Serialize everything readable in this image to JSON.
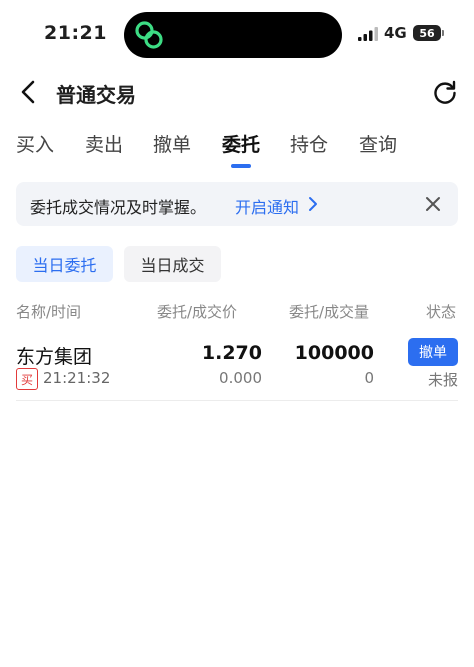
{
  "status_bar": {
    "time": "21:21",
    "network": "4G",
    "battery": "56"
  },
  "header": {
    "title": "普通交易"
  },
  "tabs": [
    {
      "label": "买入",
      "active": false
    },
    {
      "label": "卖出",
      "active": false
    },
    {
      "label": "撤单",
      "active": false
    },
    {
      "label": "委托",
      "active": true
    },
    {
      "label": "持仓",
      "active": false
    },
    {
      "label": "查询",
      "active": false
    }
  ],
  "banner": {
    "text": "委托成交情况及时掌握。",
    "link": "开启通知"
  },
  "subtabs": [
    {
      "label": "当日委托",
      "active": true
    },
    {
      "label": "当日成交",
      "active": false
    }
  ],
  "columns": [
    "名称/时间",
    "委托/成交价",
    "委托/成交量",
    "状态"
  ],
  "orders": [
    {
      "name": "东方集团",
      "side": "买",
      "time": "21:21:32",
      "order_price": "1.270",
      "deal_price": "0.000",
      "order_qty": "100000",
      "deal_qty": "0",
      "action": "撤单",
      "status": "未报"
    }
  ],
  "colors": {
    "accent": "#2c6ef0",
    "buy": "#e23a3a",
    "island_logo": "#3ddc84"
  },
  "icons": [
    "link-logo-icon",
    "signal-icon",
    "battery-icon",
    "back-icon",
    "refresh-icon",
    "chevron-right-icon",
    "close-icon"
  ]
}
